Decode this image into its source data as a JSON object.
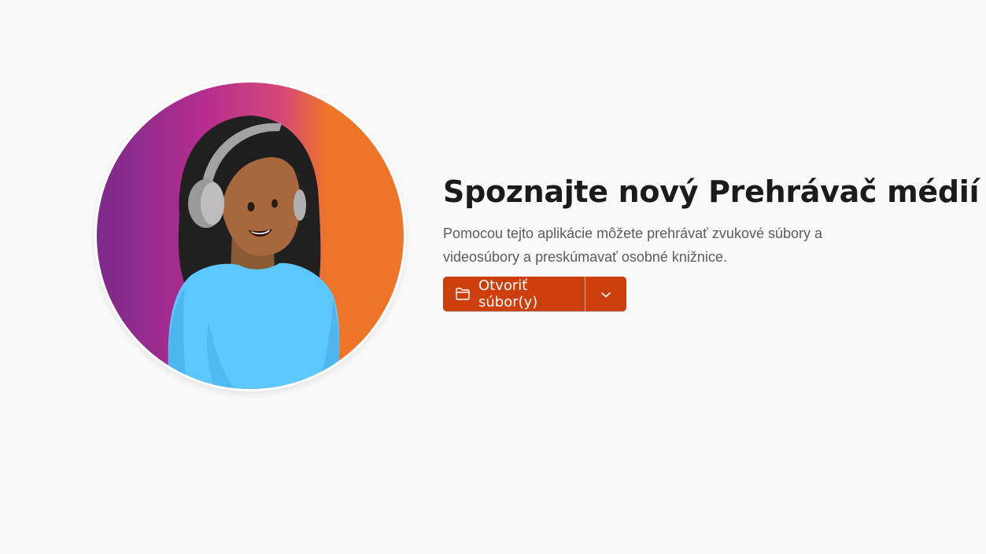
{
  "welcome": {
    "title": "Spoznajte nový Prehrávač médií",
    "description": "Pomocou tejto aplikácie môžete prehrávať zvukové súbory a videosúbory a preskúmavať osobné knižnice.",
    "open_button_label": "Otvoriť súbor(y)",
    "open_button_icon": "folder-icon",
    "dropdown_icon": "chevron-down-icon",
    "hero_image": "person-with-headphones-illustration"
  },
  "colors": {
    "background": "#f9f9f9",
    "accent": "#cc3f0c",
    "title_text": "#1b1b1b",
    "description_text": "#5c5c5c",
    "gradient_start": "#7b2a8c",
    "gradient_mid": "#c2367f",
    "gradient_end": "#ee7428",
    "shirt": "#5cc8ff"
  }
}
